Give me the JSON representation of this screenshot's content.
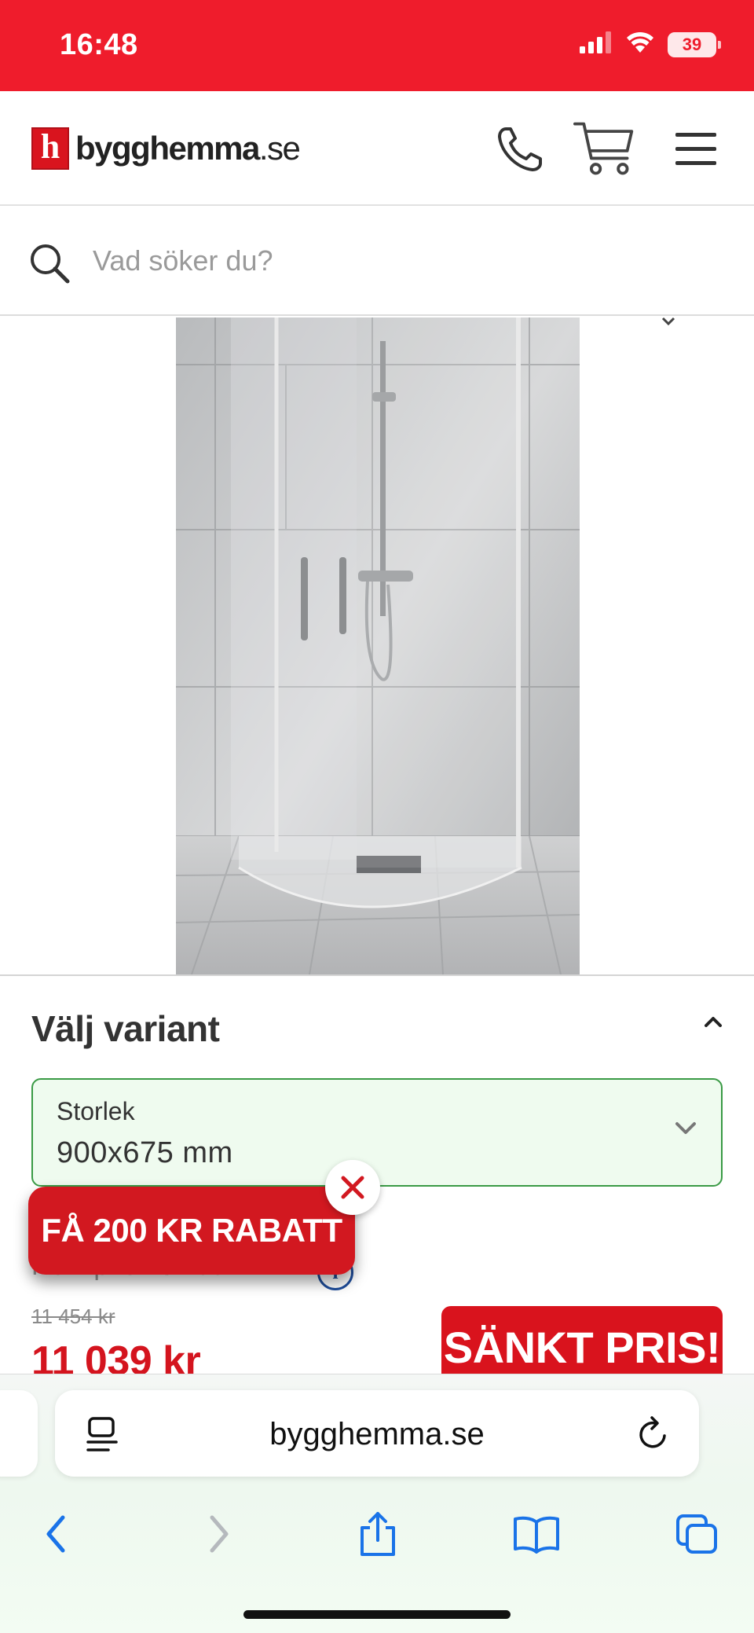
{
  "status_bar": {
    "time": "16:48",
    "battery": "39"
  },
  "header": {
    "logo_mark": "h",
    "logo_text_bold": "bygghemma",
    "logo_text_suffix": ".se"
  },
  "search": {
    "placeholder": "Vad söker du?"
  },
  "variant": {
    "title": "Välj variant",
    "size_label": "Storlek",
    "size_value": "900x675 mm"
  },
  "pricing": {
    "ref_price": "Rek. pris 13 799 kr",
    "old_price": "11 454 kr",
    "sale_price": "11 039 kr",
    "sale_badge": "SÄNKT PRIS!"
  },
  "promo": {
    "label": "FÅ 200 KR RABATT"
  },
  "browser": {
    "url": "bygghemma.se"
  },
  "colors": {
    "brand_red": "#ef1c2c",
    "select_border": "#3a9a45",
    "ios_blue": "#1a73e8"
  }
}
